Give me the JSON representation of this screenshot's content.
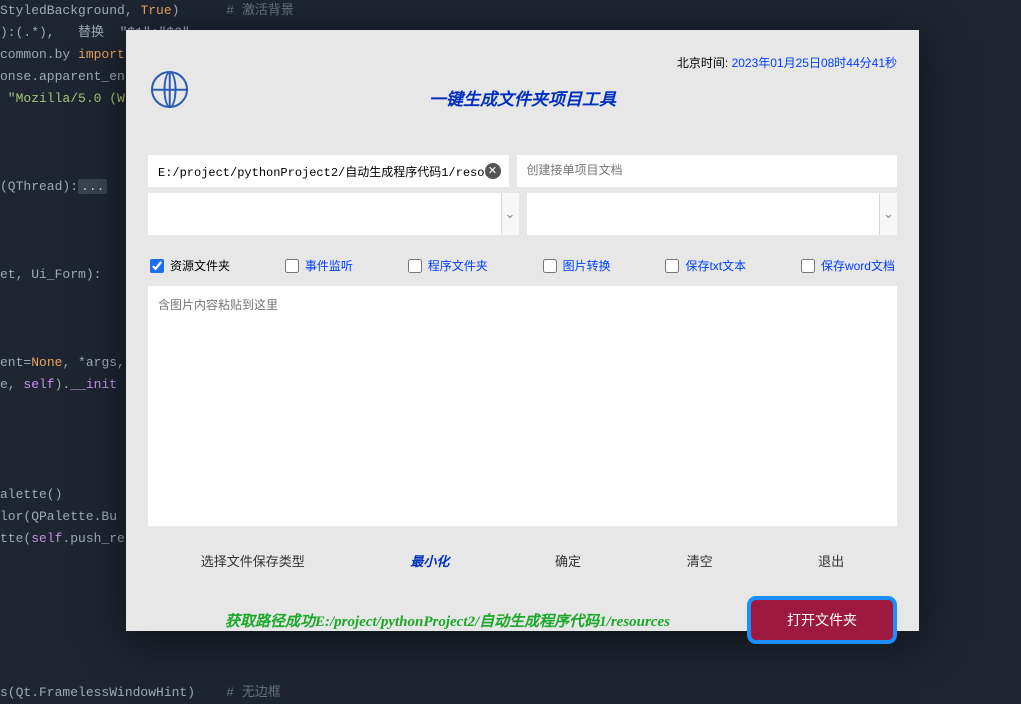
{
  "code": {
    "line1_a": "StyledBackground, ",
    "line1_b": "True",
    "line1_c": ")      ",
    "line1_comment": "# 激活背景",
    "line2": "):(.*),   替换  \"$1\":\"$2\",",
    "line3_a": "common.by ",
    "line3_b": "import",
    "line4": "onse.apparent_en",
    "line5": " \"Mozilla/5.0 (W",
    "line6_a": "(QThread):",
    "line6_b": "...",
    "line7": "et, Ui_Form):",
    "line8_a": "ent=",
    "line8_b": "None",
    "line8_c": ", *args,",
    "line9_a": "e, ",
    "line9_b": "self",
    "line9_c": ").",
    "line9_d": "__init",
    "line10": "alette()",
    "line11": "lor(QPalette.Bu",
    "line12_a": "tte(",
    "line12_b": "self",
    "line12_c": ".push_re",
    "line13_a": "s(Qt.FramelessWindowHint)    ",
    "line13_comment": "# 无边框"
  },
  "header": {
    "clock_label": "北京时间: ",
    "clock_value": "2023年01月25日08时44分41秒",
    "title": "一键生成文件夹项目工具"
  },
  "inputs": {
    "path_value": "E:/project/pythonProject2/自动生成程序代码1/resources",
    "doc_placeholder": "创建接单项目文档"
  },
  "checks": {
    "c1": "资源文件夹",
    "c2": "事件监听",
    "c3": "程序文件夹",
    "c4": "图片转换",
    "c5": "保存txt文本",
    "c6": "保存word文档"
  },
  "textarea": {
    "placeholder": "含图片内容粘贴到这里"
  },
  "buttons": {
    "save_type": "选择文件保存类型",
    "minimize": "最小化",
    "confirm": "确定",
    "clear": "清空",
    "exit": "退出"
  },
  "status": {
    "text": "获取路径成功E:/project/pythonProject2/自动生成程序代码1/resources",
    "open_btn": "打开文件夹"
  }
}
